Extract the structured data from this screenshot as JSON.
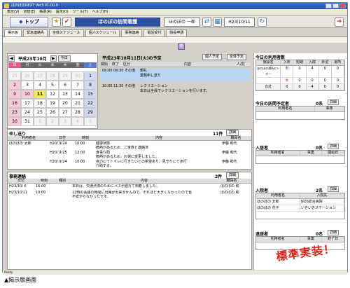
{
  "window": {
    "title": "ほのぼのNEXT Ver3.01.00.0"
  },
  "menu": [
    "表示(V)",
    "切替(E)",
    "帳票(R)",
    "設定(O)",
    "ツール(T)",
    "ヘルプ(H)"
  ],
  "toolbar": {
    "top_label": "トップ",
    "facility_title": "ほのぼの訪問看護",
    "user_name": "ほのぼの 一郎",
    "date_value": "H23/10/11"
  },
  "tabs": [
    "掲示板",
    "緊急連絡先",
    "全体スケジュール",
    "個人スケジュール",
    "事務連絡",
    "電話受付",
    "院長申請"
  ],
  "purple_button": "閉",
  "calendar": {
    "month_label": "平成23年10月",
    "today_label": "今日",
    "dow": [
      "日",
      "月",
      "火",
      "水",
      "木",
      "金",
      "土"
    ],
    "weeks": [
      [
        {
          "d": "25",
          "t": "other"
        },
        {
          "d": "26",
          "t": "other"
        },
        {
          "d": "27",
          "t": "other"
        },
        {
          "d": "28",
          "t": "other"
        },
        {
          "d": "29",
          "t": "other"
        },
        {
          "d": "30",
          "t": "other"
        },
        {
          "d": "1",
          "t": "sat"
        }
      ],
      [
        {
          "d": "2",
          "t": "sun"
        },
        {
          "d": "3",
          "t": ""
        },
        {
          "d": "4",
          "t": ""
        },
        {
          "d": "5",
          "t": ""
        },
        {
          "d": "6",
          "t": ""
        },
        {
          "d": "7",
          "t": ""
        },
        {
          "d": "8",
          "t": "sat"
        }
      ],
      [
        {
          "d": "9",
          "t": "sun"
        },
        {
          "d": "10",
          "t": "sun"
        },
        {
          "d": "11",
          "t": "today"
        },
        {
          "d": "12",
          "t": ""
        },
        {
          "d": "13",
          "t": ""
        },
        {
          "d": "14",
          "t": ""
        },
        {
          "d": "15",
          "t": "sat"
        }
      ],
      [
        {
          "d": "16",
          "t": "sun"
        },
        {
          "d": "17",
          "t": ""
        },
        {
          "d": "18",
          "t": ""
        },
        {
          "d": "19",
          "t": ""
        },
        {
          "d": "20",
          "t": ""
        },
        {
          "d": "21",
          "t": ""
        },
        {
          "d": "22",
          "t": "sat"
        }
      ],
      [
        {
          "d": "23",
          "t": "sun"
        },
        {
          "d": "24",
          "t": ""
        },
        {
          "d": "25",
          "t": ""
        },
        {
          "d": "26",
          "t": ""
        },
        {
          "d": "27",
          "t": ""
        },
        {
          "d": "28",
          "t": ""
        },
        {
          "d": "29",
          "t": "sat"
        }
      ],
      [
        {
          "d": "30",
          "t": "sun"
        },
        {
          "d": "31",
          "t": ""
        },
        {
          "d": "1",
          "t": "other"
        },
        {
          "d": "2",
          "t": "other"
        },
        {
          "d": "3",
          "t": "other"
        },
        {
          "d": "4",
          "t": "other"
        },
        {
          "d": "5",
          "t": "other"
        }
      ]
    ]
  },
  "schedule": {
    "title": "平成23年10月11日(火)の予定",
    "personal_btn": "個人予定",
    "all_btn": "全体予定",
    "headers": [
      "開始",
      "終了",
      "区分",
      "内容",
      "人/対"
    ],
    "rows": [
      {
        "start": "08:00",
        "end": "08:30",
        "kind": "その他",
        "content": "朝礼",
        "content2": "業務申し送り"
      },
      {
        "start": "10:00",
        "end": "11:30",
        "kind": "その他",
        "content": "レクリエーション",
        "content2": "本日は全員でレクリエーションを行います。"
      }
    ]
  },
  "moushi": {
    "title": "申し送り",
    "count": "11件",
    "detail_btn": "詳細",
    "headers": [
      "利用者名",
      "日付",
      "時刻",
      "内容",
      "職員名"
    ],
    "rows": [
      {
        "name": "ほのぼの 太郎",
        "date": "H20/ 9/24",
        "time": "10:00",
        "content": "健康状態",
        "content2": "微熱があるため、ご家族と連絡済",
        "staff": "伊藤 和代"
      },
      {
        "name": "",
        "date": "H20/ 9/25",
        "time": "12:00",
        "content": "食事介助",
        "content2": "微熱があるため、お粥に変更しました。",
        "staff": "伊藤 和代"
      },
      {
        "name": "",
        "date": "H20/ 9/24",
        "time": "10:00",
        "content": "自力にてトイレに行きたいとの希望あり、見守りにて歩行",
        "content2": "介助する。",
        "staff": "伊藤 和代"
      }
    ]
  },
  "jimu": {
    "title": "事務連絡",
    "count": "2件",
    "detail_btn": "詳細",
    "headers": [
      "日付",
      "時刻",
      "種別",
      "内容",
      "職員名"
    ],
    "rows": [
      {
        "date": "H23/10/ 6",
        "time": "16:00",
        "content": "本日は、交通渋滞のためにバスが遅れて到着しました。",
        "staff": "ほのぼの 和"
      },
      {
        "date": "H23/10/11",
        "time": "10:00",
        "content": "12時の会議の時間に出席が出来ませんので、それほど大きくなかったので皆",
        "content2": "不安がらなかったです。",
        "staff": "ほのぼの 和"
      }
    ]
  },
  "right": {
    "usage_title": "今日の利用者数",
    "usage_headers": [
      "施設名",
      "入所",
      "短期",
      "入院",
      "外泊",
      "退所"
    ],
    "usage_label": "ほのぼの通所センター",
    "usage_male": "男",
    "usage_female": "女",
    "usage_total_label": "合計",
    "male_vals": [
      "0",
      "0",
      "4",
      "0",
      "0"
    ],
    "female_vals": [
      "0",
      "0",
      "0",
      "0",
      "0"
    ],
    "total_vals": [
      "0",
      "0",
      "4",
      "0",
      "0"
    ],
    "plan_title": "今日の訪問予定者",
    "plan_count": "0名",
    "plan_detail": "詳細",
    "plan_headers": [
      "利用者名",
      "事務"
    ],
    "nyusho_title": "入居者",
    "nyusho_count": "0名",
    "nyusho_detail": "詳細",
    "nyusho_headers": [
      "利用者名",
      "事業",
      "開始日"
    ],
    "nyuin_title": "入院者",
    "nyuin_count": "2名",
    "nyuin_detail": "詳細",
    "nyuin_headers": [
      "利用者名",
      "入院先"
    ],
    "nyuin_rows": [
      {
        "name": "ほのぼの 太郎",
        "place": "NDS総合病院"
      },
      {
        "name": "ほのぼの 花子",
        "place": "いきいきステーション"
      }
    ],
    "taisho_title": "退居者",
    "taisho_count": "0名",
    "taisho_detail": "詳細",
    "taisho_headers": [
      "利用者名",
      "事業",
      "終了日"
    ]
  },
  "status": "Ready",
  "stamp": "標準実装！",
  "caption": "▲掲示版画面"
}
